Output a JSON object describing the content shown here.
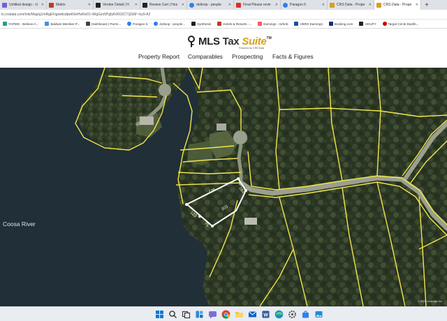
{
  "browser": {
    "tabs": [
      {
        "label": "Untitled design - U",
        "favicon_color": "#7a5cd8",
        "active": false
      },
      {
        "label": "Matrix",
        "favicon_color": "#c0392b",
        "active": false
      },
      {
        "label": "Vendor Detail | H",
        "favicon_color": "#222222",
        "active": false
      },
      {
        "label": "Review Cart | Hos",
        "favicon_color": "#222222",
        "active": false
      },
      {
        "label": "dotloop - people",
        "favicon_color": "#2f80ed",
        "active": false
      },
      {
        "label": "Final Please revie",
        "favicon_color": "#d93025",
        "active": false
      },
      {
        "label": "Paragon 5",
        "favicon_color": "#2f80ed",
        "active": false
      },
      {
        "label": "CRS Data - Prope",
        "favicon_color": "#d6a21a",
        "active": false
      },
      {
        "label": "CRS Data - Prope",
        "favicon_color": "#d6a21a",
        "active": true
      }
    ],
    "new_tab_label": "+",
    "url": "ls.crsdata.com/mls/Map/g1mRgEFqpwdcdpwK6eHwNv01-iWgGzo5PgfyK060ZCTQGM~Ivy9-A2",
    "bookmarks": [
      {
        "label": "YAPMO - Believe A...",
        "favicon_color": "#2a9d8f"
      },
      {
        "label": "Baldwin Member P...",
        "favicon_color": "#4a90d9"
      },
      {
        "label": "Dashboard | Parmi...",
        "favicon_color": "#444444"
      },
      {
        "label": "Paragon 5",
        "favicon_color": "#2f80ed"
      },
      {
        "label": "dotloop - people...",
        "favicon_color": "#2f80ed"
      },
      {
        "label": "Synthesis",
        "favicon_color": "#222222"
      },
      {
        "label": "Hotels & Resorts -...",
        "favicon_color": "#c0392b"
      },
      {
        "label": "Earnings - Airbnb",
        "favicon_color": "#ff5a5f"
      },
      {
        "label": "VBRO Earnings",
        "favicon_color": "#1f4e9c"
      },
      {
        "label": "Booking.com",
        "favicon_color": "#003580"
      },
      {
        "label": "HOUFY",
        "favicon_color": "#222222"
      },
      {
        "label": "Target Circle Dashb...",
        "favicon_color": "#cc0000"
      }
    ]
  },
  "site": {
    "logo_mls": "MLS",
    "logo_tax": "Tax",
    "logo_suite": "Suite",
    "logo_tm": "TM",
    "logo_sub": "Powered by CRS Data",
    "brand_color": "#d6a21a",
    "nav": [
      "Property Report",
      "Comparables",
      "Prospecting",
      "Facts & Figures"
    ]
  },
  "map": {
    "river_label": "Coosa River",
    "parcel_dims": {
      "north": "136",
      "east": "164",
      "west": "123",
      "south": "75",
      "diagonal": "303"
    },
    "boundary_color": "#f2e64b",
    "selected_parcel_color": "#ffffff",
    "attribution": "© 2022 CoreLogic Inc"
  },
  "taskbar": {
    "icons": [
      "windows-start-icon",
      "search-icon",
      "task-view-icon",
      "widgets-icon",
      "chat-icon",
      "chrome-icon",
      "file-explorer-icon",
      "mail-icon",
      "word-icon",
      "edge-icon",
      "settings-icon",
      "store-icon",
      "photos-icon"
    ]
  }
}
